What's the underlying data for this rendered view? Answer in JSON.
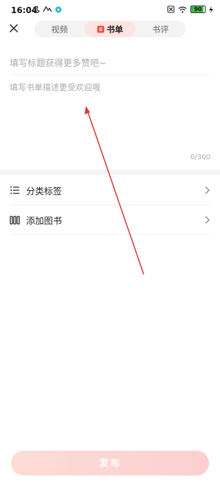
{
  "status_bar": {
    "time": "16:04",
    "battery": "90"
  },
  "tabs": [
    {
      "label": "视频",
      "active": false
    },
    {
      "label": "书单",
      "active": true
    },
    {
      "label": "书评",
      "active": false
    }
  ],
  "form": {
    "title_placeholder": "填写标题获得更多赞吧~",
    "description_placeholder": "填写书单描述更受欢迎哦",
    "counter": "0/300"
  },
  "rows": [
    {
      "label": "分类标签",
      "icon": "list-icon"
    },
    {
      "label": "添加图书",
      "icon": "books-icon"
    }
  ],
  "publish_label": "发布",
  "colors": {
    "accent": "#e8453c",
    "tab_active_bg": "#fde4e2",
    "publish_bg": "#fbd6d2",
    "annotation_arrow": "#d93a3a"
  }
}
